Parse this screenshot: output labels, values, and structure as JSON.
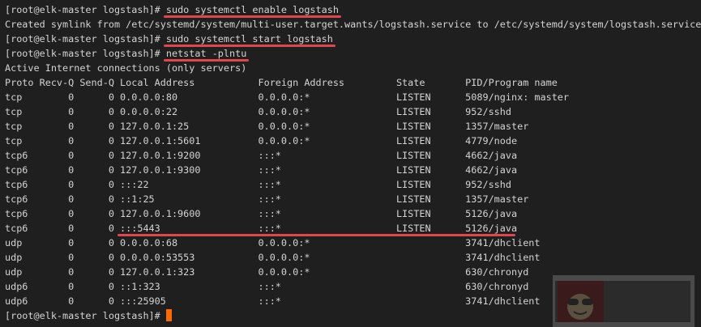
{
  "terminal": {
    "prompt": "[root@elk-master logstash]# ",
    "commands": [
      "sudo systemctl enable logstash",
      "sudo systemctl start logstash",
      "netstat -plntu"
    ],
    "symlink_output": "Created symlink from /etc/systemd/system/multi-user.target.wants/logstash.service to /etc/systemd/system/logstash.service.",
    "netstat_title": "Active Internet connections (only servers)",
    "headers": [
      "Proto",
      "Recv-Q",
      "Send-Q",
      "Local Address",
      "Foreign Address",
      "State",
      "PID/Program name"
    ],
    "rows": [
      [
        "tcp",
        "0",
        "0",
        "0.0.0.0:80",
        "0.0.0.0:*",
        "LISTEN",
        "5089/nginx: master"
      ],
      [
        "tcp",
        "0",
        "0",
        "0.0.0.0:22",
        "0.0.0.0:*",
        "LISTEN",
        "952/sshd"
      ],
      [
        "tcp",
        "0",
        "0",
        "127.0.0.1:25",
        "0.0.0.0:*",
        "LISTEN",
        "1357/master"
      ],
      [
        "tcp",
        "0",
        "0",
        "127.0.0.1:5601",
        "0.0.0.0:*",
        "LISTEN",
        "4779/node"
      ],
      [
        "tcp6",
        "0",
        "0",
        "127.0.0.1:9200",
        ":::*",
        "LISTEN",
        "4662/java"
      ],
      [
        "tcp6",
        "0",
        "0",
        "127.0.0.1:9300",
        ":::*",
        "LISTEN",
        "4662/java"
      ],
      [
        "tcp6",
        "0",
        "0",
        ":::22",
        ":::*",
        "LISTEN",
        "952/sshd"
      ],
      [
        "tcp6",
        "0",
        "0",
        "::1:25",
        ":::*",
        "LISTEN",
        "1357/master"
      ],
      [
        "tcp6",
        "0",
        "0",
        "127.0.0.1:9600",
        ":::*",
        "LISTEN",
        "5126/java"
      ],
      [
        "tcp6",
        "0",
        "0",
        ":::5443",
        ":::*",
        "LISTEN",
        "5126/java"
      ],
      [
        "udp",
        "0",
        "0",
        "0.0.0.0:68",
        "0.0.0.0:*",
        "",
        "3741/dhclient"
      ],
      [
        "udp",
        "0",
        "0",
        "0.0.0.0:53553",
        "0.0.0.0:*",
        "",
        "3741/dhclient"
      ],
      [
        "udp",
        "0",
        "0",
        "127.0.0.1:323",
        "0.0.0.0:*",
        "",
        "630/chronyd"
      ],
      [
        "udp6",
        "0",
        "0",
        "::1:323",
        ":::*",
        "",
        "630/chronyd"
      ],
      [
        "udp6",
        "0",
        "0",
        ":::25905",
        ":::*",
        "",
        "3741/dhclient"
      ]
    ],
    "highlighted_row": 9
  },
  "colors": {
    "background": "#1f1f1f",
    "text": "#d4d4d4",
    "underline": "#e0464e",
    "cursor": "#ff6a00"
  }
}
